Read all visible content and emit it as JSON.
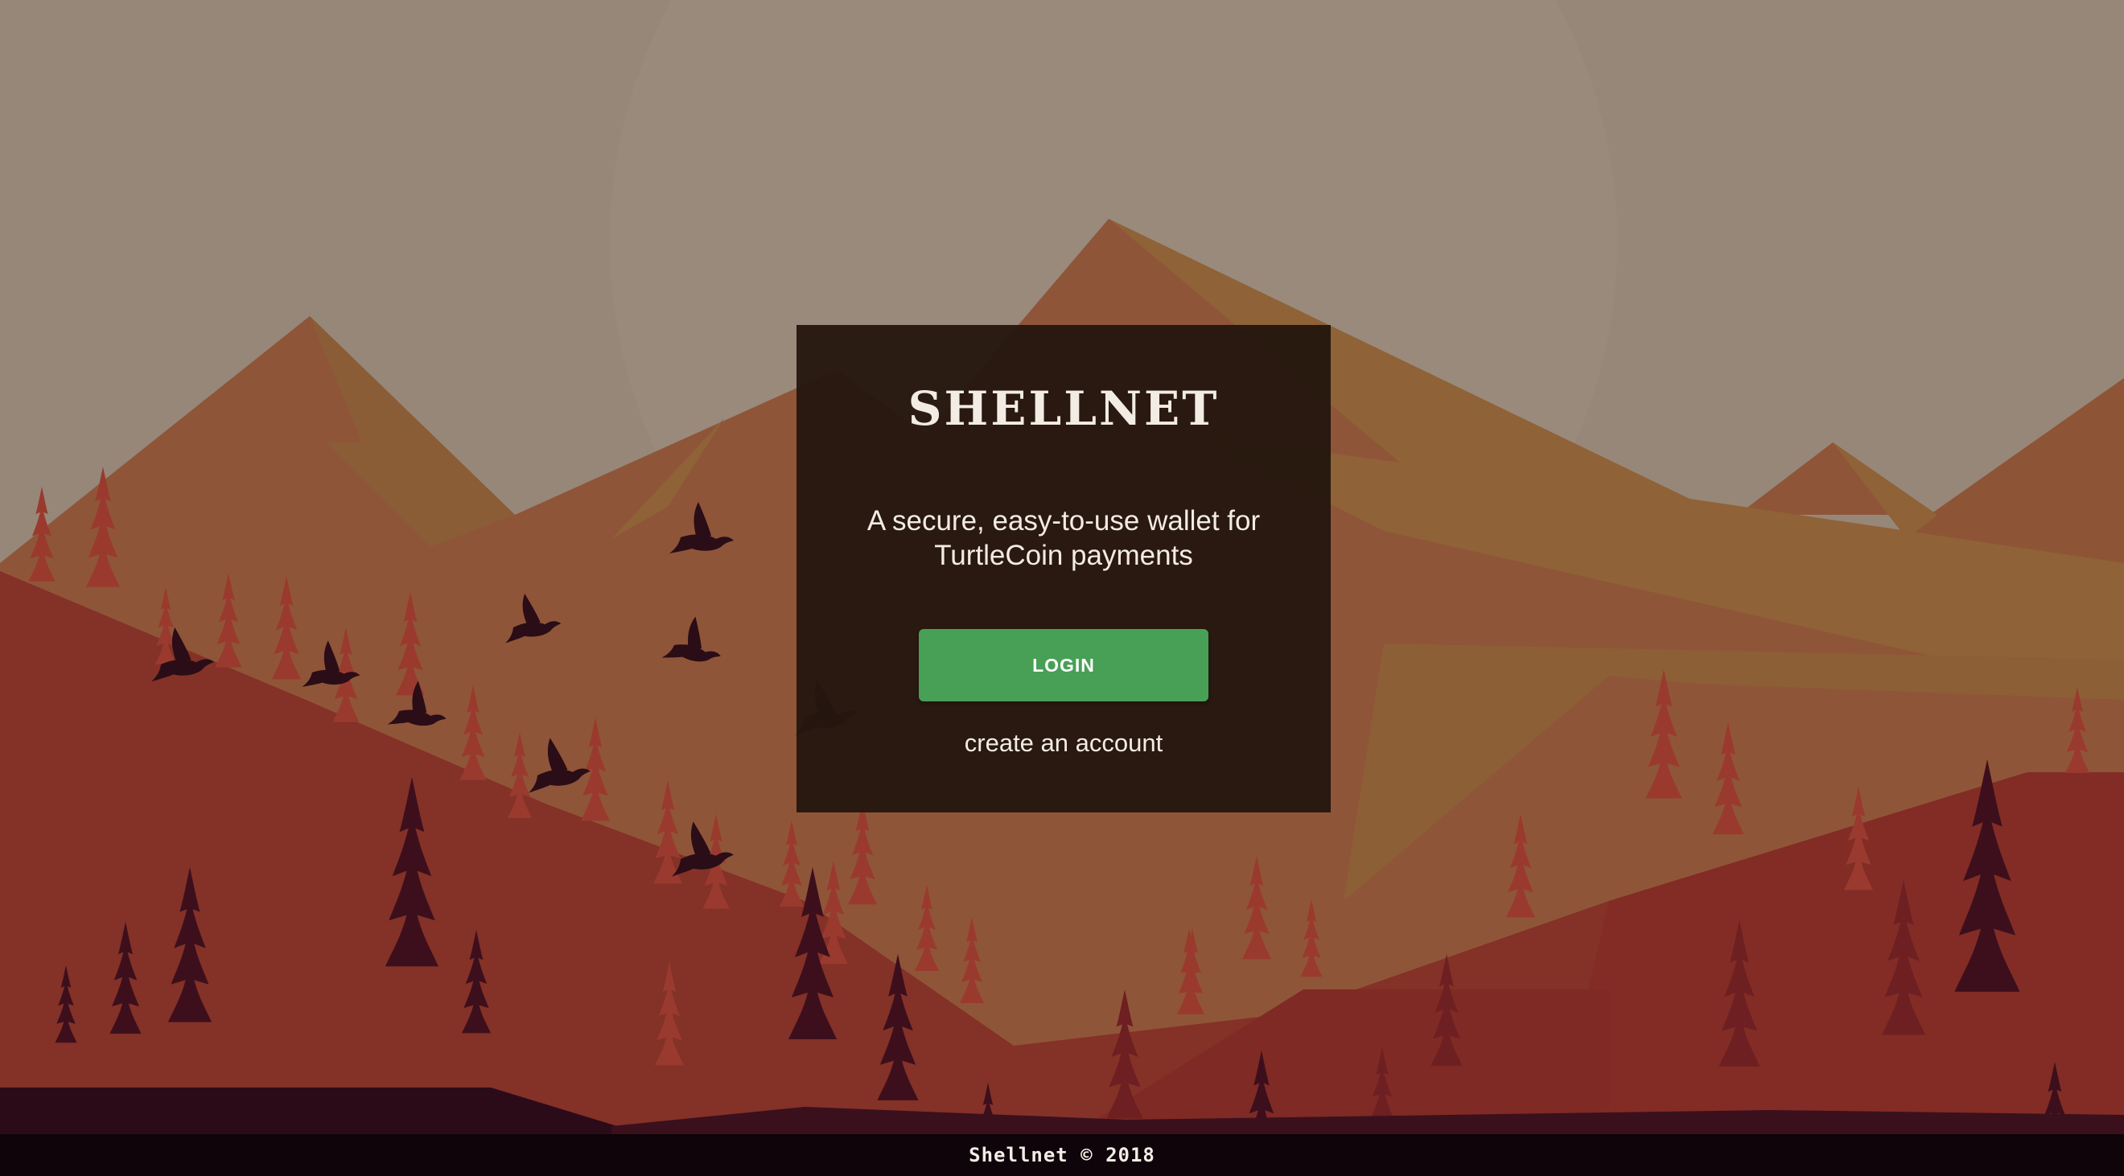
{
  "app": {
    "title": "SHELLNET",
    "tagline": "A secure, easy-to-use wallet for TurtleCoin payments"
  },
  "actions": {
    "login_label": "LOGIN",
    "create_account_label": "create an account"
  },
  "footer": {
    "text": "Shellnet © 2018"
  },
  "icons": {
    "background": "mountain-forest-illustration",
    "birds": "bird-silhouette"
  },
  "colors": {
    "sky": "#978779",
    "card": "#24160e",
    "login_button": "#47a055",
    "text": "#f3ece4",
    "footer": "#0e0409"
  }
}
